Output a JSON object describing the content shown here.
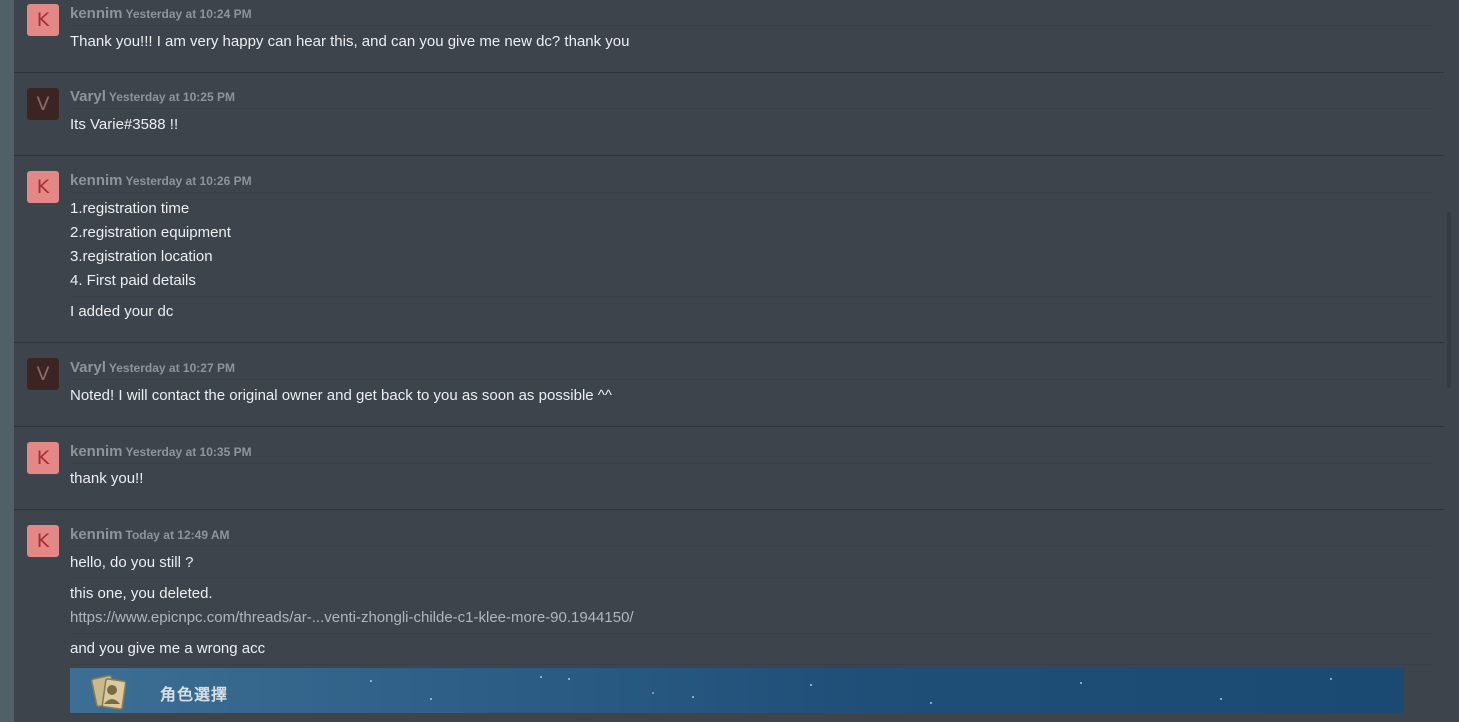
{
  "colors": {
    "panel_bg": "#3e444c",
    "outer_bg": "#4e5d64",
    "text": "#eceef0",
    "meta": "#8e949c",
    "avatar_k_bg": "#e38787",
    "avatar_k_fg": "#a72e2e",
    "avatar_v_bg": "#3a2523",
    "avatar_v_fg": "#8a6b64"
  },
  "messages": [
    {
      "avatar_letter": "K",
      "author": "kennim",
      "time": "Yesterday at 10:24 PM",
      "lines": [
        "Thank you!!! I am very happy can hear this, and can you give me new dc? thank you"
      ]
    },
    {
      "avatar_letter": "V",
      "author": "Varyl",
      "time": "Yesterday at 10:25 PM",
      "lines": [
        "Its Varie#3588 !!"
      ]
    },
    {
      "avatar_letter": "K",
      "author": "kennim",
      "time": "Yesterday at 10:26 PM",
      "lines": [
        "1.registration time",
        "2.registration equipment",
        "3.registration location",
        "4. First paid details",
        "I added your dc"
      ]
    },
    {
      "avatar_letter": "V",
      "author": "Varyl",
      "time": "Yesterday at 10:27 PM",
      "lines": [
        "Noted! I will contact the original owner and get back to you as soon as possible ^^"
      ]
    },
    {
      "avatar_letter": "K",
      "author": "kennim",
      "time": "Yesterday at 10:35 PM",
      "lines": [
        "thank you!!"
      ]
    },
    {
      "avatar_letter": "K",
      "author": "kennim",
      "time": "Today at 12:49 AM",
      "lines": [
        "hello, do you still ?",
        "this one, you deleted.",
        "https://www.epicnpc.com/threads/ar-...venti-zhongli-childe-c1-klee-more-90.1944150/",
        "and you give me a wrong acc"
      ],
      "attachment": {
        "title": "角色選擇",
        "icon": "character-cards-icon"
      }
    }
  ]
}
